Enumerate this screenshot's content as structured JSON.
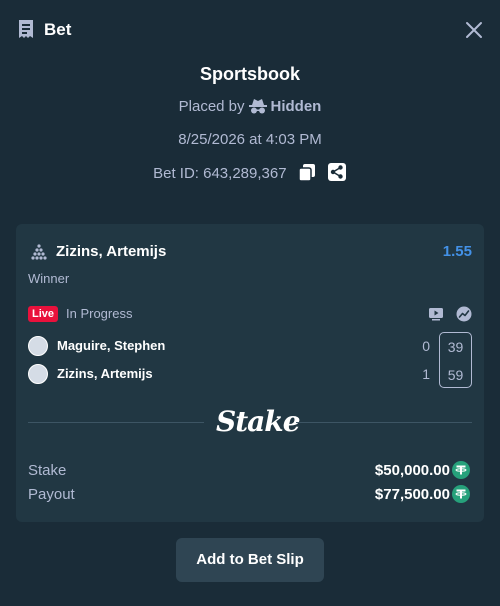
{
  "header": {
    "title": "Bet"
  },
  "bet": {
    "source": "Sportsbook",
    "placed_by_prefix": "Placed by",
    "placed_by_user": "Hidden",
    "datetime": "8/25/2026 at 4:03 PM",
    "bet_id_text": "Bet ID: 643,289,367"
  },
  "event": {
    "name": "Zizins, Artemijs",
    "odds": "1.55",
    "market": "Winner",
    "live_label": "Live",
    "status": "In Progress",
    "players": [
      {
        "name": "Maguire, Stephen",
        "sets": "0",
        "score": "39"
      },
      {
        "name": "Zizins, Artemijs",
        "sets": "1",
        "score": "59"
      }
    ]
  },
  "brand": {
    "logo_text": "Stake"
  },
  "summary": {
    "stake_label": "Stake",
    "stake_value": "$50,000.00",
    "payout_label": "Payout",
    "payout_value": "$77,500.00",
    "currency_icon": "tether-icon"
  },
  "actions": {
    "add_to_slip": "Add to Bet Slip"
  },
  "colors": {
    "background": "#1a2c38",
    "card": "#213743",
    "odds": "#4391e7",
    "live": "#e9113c",
    "tether": "#26a17b",
    "button": "#2f4553"
  }
}
